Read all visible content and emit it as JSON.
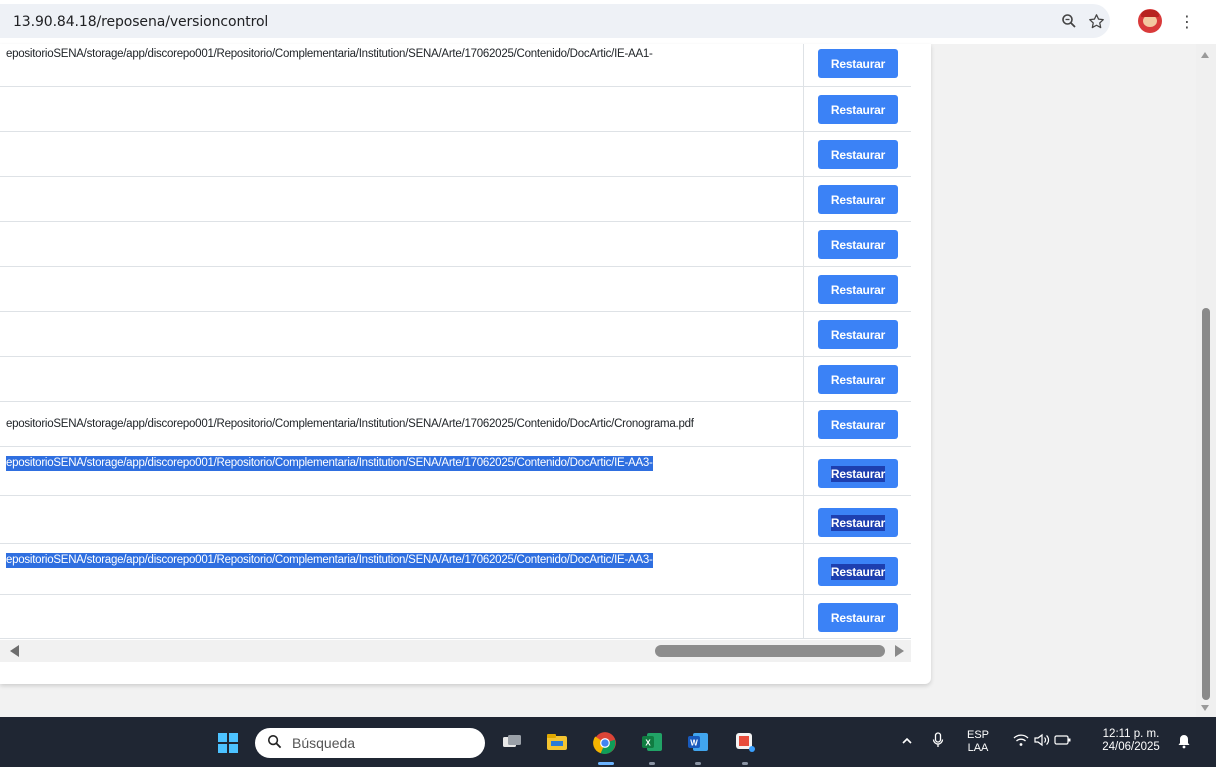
{
  "browser": {
    "url": "13.90.84.18/reposena/versioncontrol",
    "zoom_icon": "zoom-icon",
    "star_icon": "star-icon",
    "menu_icon": "⋮"
  },
  "table": {
    "button_label": "Restaurar",
    "rows": [
      {
        "path": "epositorioSENA/storage/app/discorepo001/Repositorio/Complementaria/Institution/SENA/Arte/17062025/Contenido/DocArtic/IE-AA1-",
        "selected": false,
        "button_selected": false
      },
      {
        "path": "",
        "selected": false,
        "button_selected": false
      },
      {
        "path": "",
        "selected": false,
        "button_selected": false
      },
      {
        "path": "",
        "selected": false,
        "button_selected": false
      },
      {
        "path": "",
        "selected": false,
        "button_selected": false
      },
      {
        "path": "",
        "selected": false,
        "button_selected": false
      },
      {
        "path": "",
        "selected": false,
        "button_selected": false
      },
      {
        "path": "",
        "selected": false,
        "button_selected": false
      },
      {
        "path": "epositorioSENA/storage/app/discorepo001/Repositorio/Complementaria/Institution/SENA/Arte/17062025/Contenido/DocArtic/Cronograma.pdf",
        "selected": false,
        "button_selected": false
      },
      {
        "path": "epositorioSENA/storage/app/discorepo001/Repositorio/Complementaria/Institution/SENA/Arte/17062025/Contenido/DocArtic/IE-AA3-",
        "selected": true,
        "button_selected": true
      },
      {
        "path": "",
        "selected": false,
        "button_selected": true
      },
      {
        "path": "epositorioSENA/storage/app/discorepo001/Repositorio/Complementaria/Institution/SENA/Arte/17062025/Contenido/DocArtic/IE-AA3-",
        "selected": true,
        "button_selected": true
      },
      {
        "path": "",
        "selected": false,
        "button_selected": false
      }
    ]
  },
  "taskbar": {
    "search_placeholder": "Búsqueda",
    "language": "ESP",
    "layout": "LAA",
    "time": "12:11 p. m.",
    "date": "24/06/2025",
    "apps": [
      "task-view",
      "file-explorer",
      "chrome",
      "excel",
      "word",
      "snipping-tool"
    ]
  },
  "colors": {
    "button": "#3b82f6",
    "selection": "#2f6fe0",
    "taskbar": "#1f2633"
  }
}
